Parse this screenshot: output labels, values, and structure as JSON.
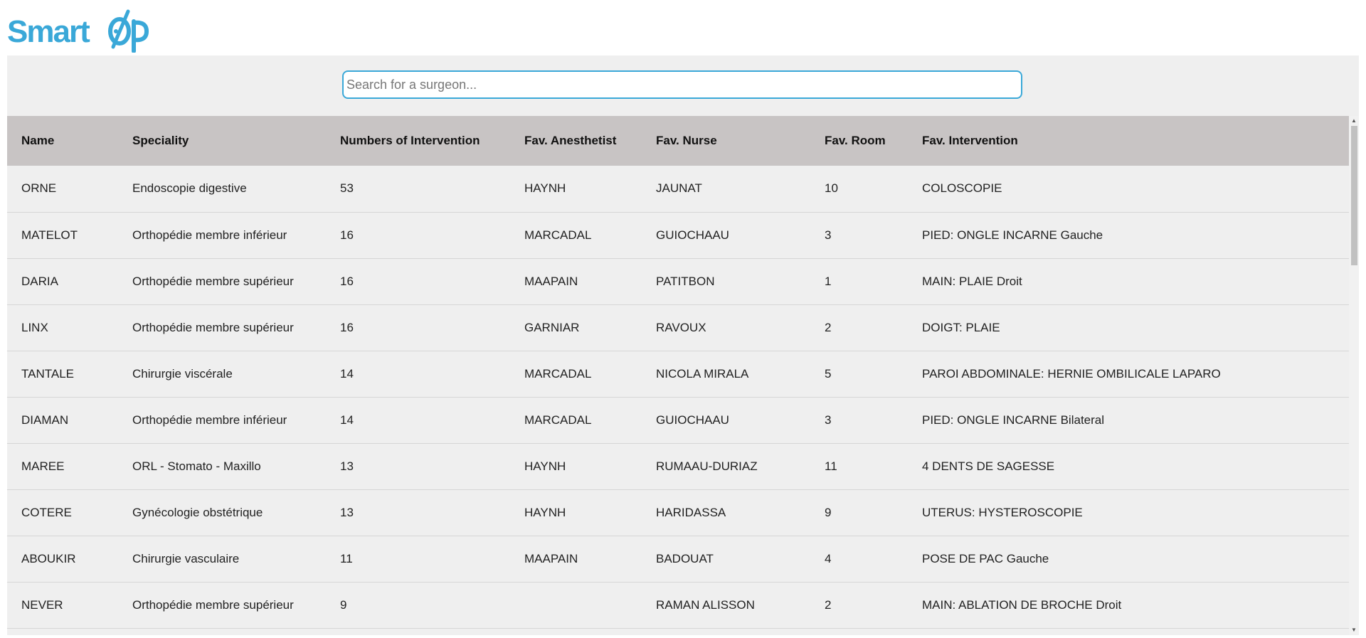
{
  "brand": {
    "logo_text": "SmartOp",
    "color": "#3aa8d8"
  },
  "search": {
    "placeholder": "Search for a surgeon...",
    "value": ""
  },
  "table": {
    "headers": [
      "Name",
      "Speciality",
      "Numbers of Intervention",
      "Fav. Anesthetist",
      "Fav. Nurse",
      "Fav. Room",
      "Fav. Intervention"
    ],
    "rows": [
      [
        "ORNE",
        "Endoscopie digestive",
        "53",
        "HAYNH",
        "JAUNAT",
        "10",
        "COLOSCOPIE"
      ],
      [
        "MATELOT",
        "Orthopédie membre inférieur",
        "16",
        "MARCADAL",
        "GUIOCHAAU",
        "3",
        "PIED: ONGLE INCARNE Gauche"
      ],
      [
        "DARIA",
        "Orthopédie membre supérieur",
        "16",
        "MAAPAIN",
        "PATITBON",
        "1",
        "MAIN: PLAIE Droit"
      ],
      [
        "LINX",
        "Orthopédie membre supérieur",
        "16",
        "GARNIAR",
        "RAVOUX",
        "2",
        "DOIGT: PLAIE"
      ],
      [
        "TANTALE",
        "Chirurgie viscérale",
        "14",
        "MARCADAL",
        "NICOLA MIRALA",
        "5",
        "PAROI ABDOMINALE: HERNIE OMBILICALE LAPARO"
      ],
      [
        "DIAMAN",
        "Orthopédie membre inférieur",
        "14",
        "MARCADAL",
        "GUIOCHAAU",
        "3",
        "PIED: ONGLE INCARNE Bilateral"
      ],
      [
        "MAREE",
        "ORL - Stomato - Maxillo",
        "13",
        "HAYNH",
        "RUMAAU-DURIAZ",
        "11",
        "4 DENTS DE SAGESSE"
      ],
      [
        "COTERE",
        "Gynécologie obstétrique",
        "13",
        "HAYNH",
        "HARIDASSA",
        "9",
        "UTERUS: HYSTEROSCOPIE"
      ],
      [
        "ABOUKIR",
        "Chirurgie vasculaire",
        "11",
        "MAAPAIN",
        "BADOUAT",
        "4",
        "POSE DE PAC Gauche"
      ],
      [
        "NEVER",
        "Orthopédie membre supérieur",
        "9",
        "",
        "RAMAN ALISSON",
        "2",
        "MAIN: ABLATION DE BROCHE Droit"
      ]
    ]
  },
  "scrollbar": {
    "position_fraction": 0.0
  }
}
